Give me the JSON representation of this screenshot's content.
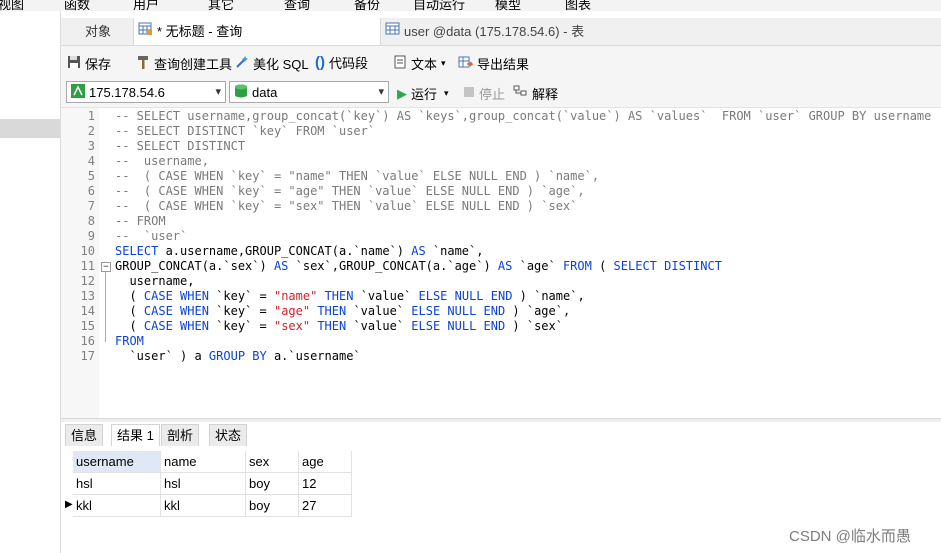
{
  "menu": [
    "视图",
    "函数",
    "用户",
    "其它",
    "查询",
    "备份",
    "自动运行",
    "模型",
    "图表"
  ],
  "tabs": {
    "objects": "对象",
    "query": "* 无标题 - 查询",
    "table": "user @data (175.178.54.6) - 表"
  },
  "toolbar": {
    "save": "保存",
    "query_builder": "查询创建工具",
    "beautify": "美化 SQL",
    "snippet": "代码段",
    "text": "文本",
    "export": "导出结果",
    "connection": "175.178.54.6",
    "database": "data",
    "run": "运行",
    "stop": "停止",
    "explain": "解释"
  },
  "editor": {
    "line_numbers": [
      "1",
      "2",
      "3",
      "4",
      "5",
      "6",
      "7",
      "8",
      "9",
      "10",
      "11",
      "12",
      "13",
      "14",
      "15",
      "16",
      "17"
    ]
  },
  "result_tabs": [
    "信息",
    "结果 1",
    "剖析",
    "状态"
  ],
  "result": {
    "columns": [
      "username",
      "name",
      "sex",
      "age"
    ],
    "rows": [
      [
        "hsl",
        "hsl",
        "boy",
        "12"
      ],
      [
        "kkl",
        "kkl",
        "boy",
        "27"
      ]
    ]
  },
  "watermark": "CSDN @临水而愚"
}
